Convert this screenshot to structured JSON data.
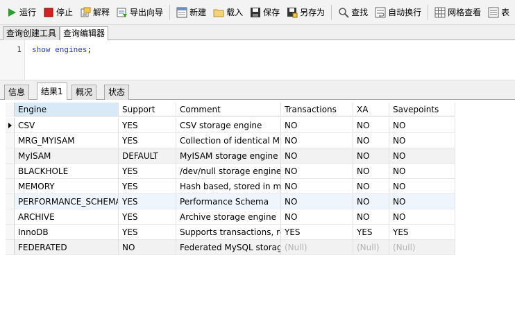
{
  "toolbar": {
    "run": "运行",
    "stop": "停止",
    "explain": "解释",
    "export_wizard": "导出向导",
    "new": "新建",
    "load": "载入",
    "save": "保存",
    "save_as": "另存为",
    "find": "查找",
    "word_wrap": "自动换行",
    "grid_view": "网格查看",
    "form": "表"
  },
  "editor_tabs": [
    "查询创建工具",
    "查询编辑器"
  ],
  "editor": {
    "line_number": "1",
    "keyword": "show engines",
    "rest": ";"
  },
  "result_tabs": [
    "信息",
    "结果1",
    "概况",
    "状态"
  ],
  "table": {
    "columns": [
      "Engine",
      "Support",
      "Comment",
      "Transactions",
      "XA",
      "Savepoints"
    ],
    "rows": [
      [
        "CSV",
        "YES",
        "CSV storage engine",
        "NO",
        "NO",
        "NO"
      ],
      [
        "MRG_MYISAM",
        "YES",
        "Collection of identical MyISAM tables",
        "NO",
        "NO",
        "NO"
      ],
      [
        "MyISAM",
        "DEFAULT",
        "MyISAM storage engine",
        "NO",
        "NO",
        "NO"
      ],
      [
        "BLACKHOLE",
        "YES",
        "/dev/null storage engine",
        "NO",
        "NO",
        "NO"
      ],
      [
        "MEMORY",
        "YES",
        "Hash based, stored in memory",
        "NO",
        "NO",
        "NO"
      ],
      [
        "PERFORMANCE_SCHEMA",
        "YES",
        "Performance Schema",
        "NO",
        "NO",
        "NO"
      ],
      [
        "ARCHIVE",
        "YES",
        "Archive storage engine",
        "NO",
        "NO",
        "NO"
      ],
      [
        "InnoDB",
        "YES",
        "Supports transactions, row-level locking",
        "YES",
        "YES",
        "YES"
      ],
      [
        "FEDERATED",
        "NO",
        "Federated MySQL storage engine",
        "(Null)",
        "(Null)",
        "(Null)"
      ]
    ]
  },
  "colors": {
    "run_green": "#2e9b2e",
    "stop_red": "#d42020",
    "sorted_header": "#d8eaf7",
    "null_text": "#b3b3b3"
  }
}
